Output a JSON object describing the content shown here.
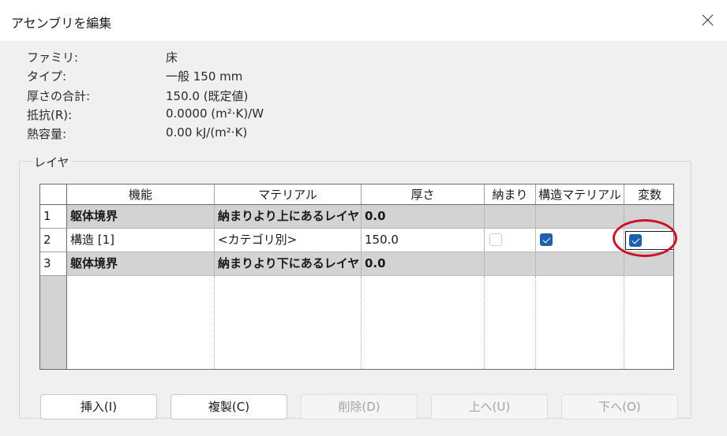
{
  "window": {
    "title": "アセンブリを編集"
  },
  "info": [
    {
      "label": "ファミリ:",
      "value": "床"
    },
    {
      "label": "タイプ:",
      "value": "一般 150 mm"
    },
    {
      "label": "厚さの合計:",
      "value": "150.0 (既定値)"
    },
    {
      "label": "抵抗(R):",
      "value": "0.0000 (m²·K)/W"
    },
    {
      "label": "熱容量:",
      "value": "0.00 kJ/(m²·K)"
    }
  ],
  "layers": {
    "group_title": "レイヤ",
    "columns": [
      "機能",
      "マテリアル",
      "厚さ",
      "納まり",
      "構造マテリアル",
      "変数"
    ],
    "rows": [
      {
        "num": "1",
        "function": "躯体境界",
        "material": "納まりより上にあるレイヤ",
        "thickness": "0.0",
        "wraps": null,
        "structural": null,
        "variable": null
      },
      {
        "num": "2",
        "function": "構造 [1]",
        "material": "<カテゴリ別>",
        "thickness": "150.0",
        "wraps": false,
        "structural": true,
        "variable": true
      },
      {
        "num": "3",
        "function": "躯体境界",
        "material": "納まりより下にあるレイヤ",
        "thickness": "0.0",
        "wraps": null,
        "structural": null,
        "variable": null
      }
    ]
  },
  "buttons": {
    "insert": "挿入(I)",
    "duplicate": "複製(C)",
    "delete": "削除(D)",
    "up": "上へ(U)",
    "down": "下へ(O)"
  },
  "colors": {
    "checkbox_checked": "#1f5fae",
    "boundary_row": "#d3d3d3",
    "highlight_annotation": "#c8142a"
  }
}
